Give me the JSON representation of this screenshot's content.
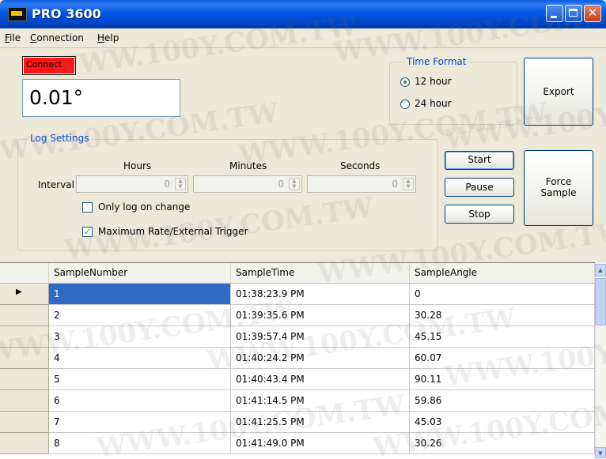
{
  "window": {
    "title": "PRO 3600"
  },
  "menu": [
    "File",
    "Connection",
    "Help"
  ],
  "connect": {
    "label": "Connect",
    "color": "#ff1414"
  },
  "reading": {
    "value": "0.01°"
  },
  "time_format": {
    "legend": "Time Format",
    "options": [
      {
        "label": "12 hour",
        "selected": true
      },
      {
        "label": "24 hour",
        "selected": false
      }
    ]
  },
  "buttons": {
    "export": "Export",
    "start": "Start",
    "pause": "Pause",
    "stop": "Stop",
    "force_sample_line1": "Force",
    "force_sample_line2": "Sample"
  },
  "log_settings": {
    "legend": "Log Settings",
    "interval_label": "Interval",
    "hours_label": "Hours",
    "minutes_label": "Minutes",
    "seconds_label": "Seconds",
    "hours_value": "0",
    "minutes_value": "0",
    "seconds_value": "0",
    "only_log_label": "Only log on change",
    "only_log_checked": false,
    "max_rate_label": "Maximum Rate/External Trigger",
    "max_rate_checked": true
  },
  "table": {
    "columns": [
      "SampleNumber",
      "SampleTime",
      "SampleAngle"
    ],
    "rows": [
      [
        "1",
        "01:38:23.9 PM",
        "0"
      ],
      [
        "2",
        "01:39:35.6 PM",
        "30.28"
      ],
      [
        "3",
        "01:39:57.4 PM",
        "45.15"
      ],
      [
        "4",
        "01:40:24.2 PM",
        "60.07"
      ],
      [
        "5",
        "01:40:43.4 PM",
        "90.11"
      ],
      [
        "6",
        "01:41:14.5 PM",
        "59.86"
      ],
      [
        "7",
        "01:41:25.5 PM",
        "45.03"
      ],
      [
        "8",
        "01:41:49.0 PM",
        "30.26"
      ]
    ],
    "selected_row": 0
  },
  "watermark": "WWW.100Y.COM.TW"
}
